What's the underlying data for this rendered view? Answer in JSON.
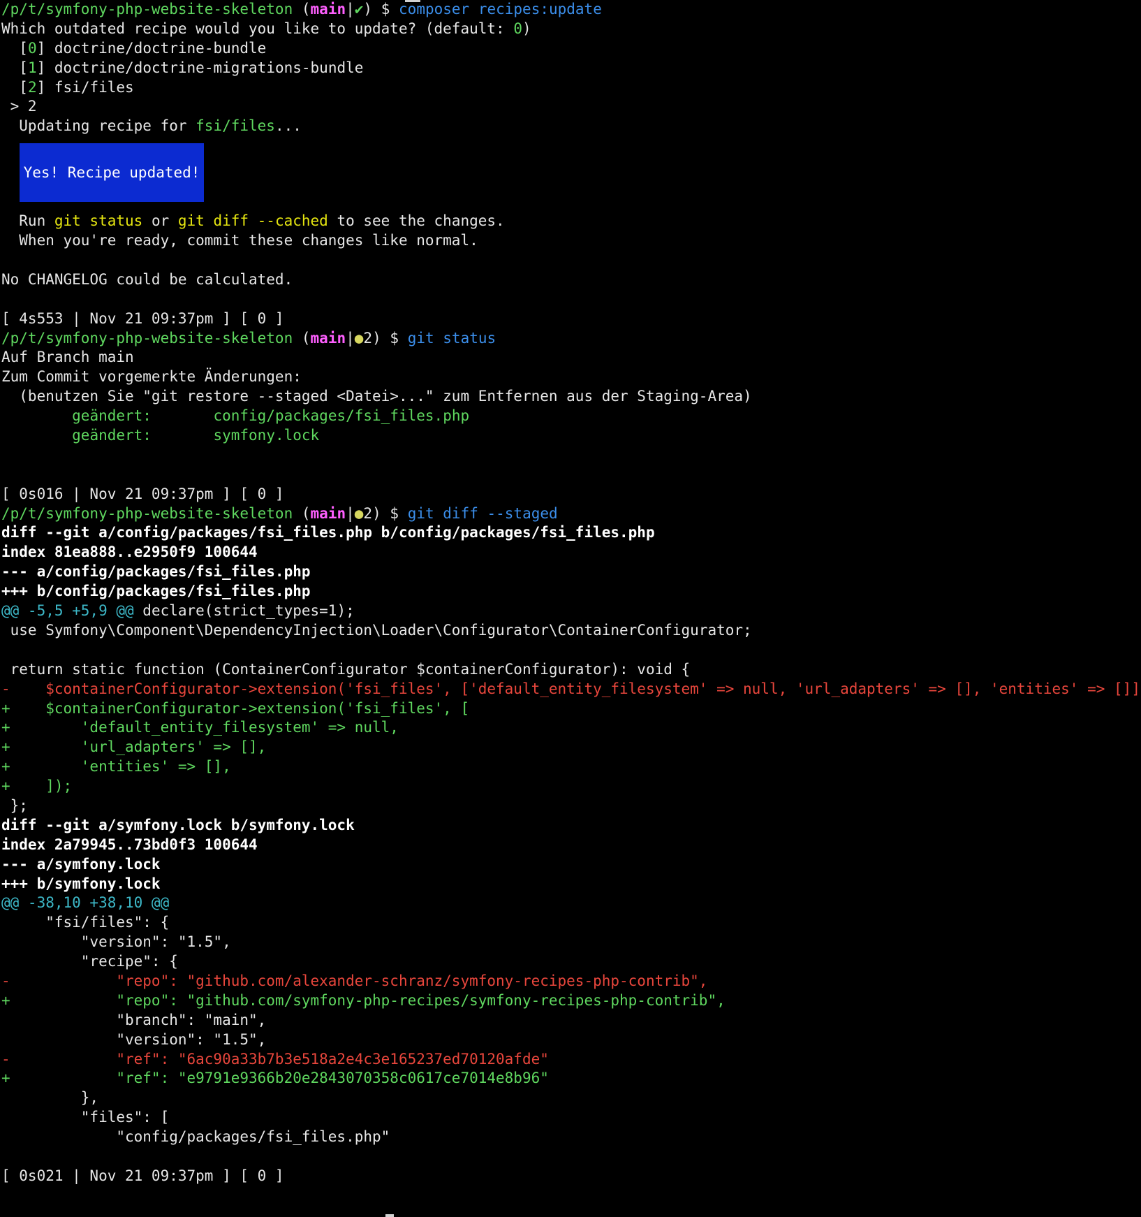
{
  "prompt": {
    "path": "/p/t/symfony-php-website-skeleton",
    "branch": "main",
    "clean_mark": "✔",
    "dirty_mark": "●",
    "dirty_count": "2",
    "dollar": "$"
  },
  "cmd1": {
    "binary": "composer",
    "args": "recipes:update"
  },
  "question": {
    "text": "Which outdated recipe would you like to update? (default: ",
    "default_value": "0",
    "close": ")"
  },
  "options": [
    {
      "index": "0",
      "name": "doctrine/doctrine-bundle"
    },
    {
      "index": "1",
      "name": "doctrine/doctrine-migrations-bundle"
    },
    {
      "index": "2",
      "name": "fsi/files"
    }
  ],
  "answer": " > 2",
  "updating": {
    "prefix": "  Updating recipe for ",
    "package": "fsi/files",
    "suffix": "..."
  },
  "banner": {
    "text": "Yes! Recipe updated!"
  },
  "hint": {
    "run": "  Run ",
    "git_status": "git status",
    "or": " or ",
    "git_diff": "git diff --cached",
    "tail": " to see the changes.",
    "line2": "  When you're ready, commit these changes like normal."
  },
  "changelog": "No CHANGELOG could be calculated.",
  "timings": {
    "t1": "[ 4s553 | Nov 21 09:37pm ] [ 0 ]",
    "t2": "[ 0s016 | Nov 21 09:37pm ] [ 0 ]",
    "t3": "[ 0s021 | Nov 21 09:37pm ] [ 0 ]"
  },
  "cmd2": {
    "binary": "git",
    "args": "status"
  },
  "status": {
    "branch_line": "Auf Branch main",
    "staged_header": "Zum Commit vorgemerkte Änderungen:",
    "restore_hint": "  (benutzen Sie \"git restore --staged <Datei>...\" zum Entfernen aus der Staging-Area)",
    "files": [
      {
        "label": "geändert:",
        "path": "config/packages/fsi_files.php"
      },
      {
        "label": "geändert:",
        "path": "symfony.lock"
      }
    ]
  },
  "cmd3": {
    "binary": "git",
    "args": "diff --staged"
  },
  "diff1": {
    "header": "diff --git a/config/packages/fsi_files.php b/config/packages/fsi_files.php",
    "index": "index 81ea888..e2950f9 100644",
    "minus_file": "--- a/config/packages/fsi_files.php",
    "plus_file": "+++ b/config/packages/fsi_files.php",
    "hunk": "@@ -5,5 +5,9 @@",
    "hunk_context": " declare(strict_types=1);",
    "lines": [
      {
        "type": "ctx",
        "text": " use Symfony\\Component\\DependencyInjection\\Loader\\Configurator\\ContainerConfigurator;"
      },
      {
        "type": "ctx",
        "text": ""
      },
      {
        "type": "ctx",
        "text": " return static function (ContainerConfigurator $containerConfigurator): void {"
      },
      {
        "type": "del",
        "text": "-    $containerConfigurator->extension('fsi_files', ['default_entity_filesystem' => null, 'url_adapters' => [], 'entities' => []]);"
      },
      {
        "type": "add",
        "text": "+    $containerConfigurator->extension('fsi_files', ["
      },
      {
        "type": "add",
        "text": "+        'default_entity_filesystem' => null,"
      },
      {
        "type": "add",
        "text": "+        'url_adapters' => [],"
      },
      {
        "type": "add",
        "text": "+        'entities' => [],"
      },
      {
        "type": "add",
        "text": "+    ]);"
      },
      {
        "type": "ctx",
        "text": " };"
      }
    ]
  },
  "diff2": {
    "header": "diff --git a/symfony.lock b/symfony.lock",
    "index": "index 2a79945..73bd0f3 100644",
    "minus_file": "--- a/symfony.lock",
    "plus_file": "+++ b/symfony.lock",
    "hunk": "@@ -38,10 +38,10 @@",
    "lines": [
      {
        "type": "ctx",
        "text": "     \"fsi/files\": {"
      },
      {
        "type": "ctx",
        "text": "         \"version\": \"1.5\","
      },
      {
        "type": "ctx",
        "text": "         \"recipe\": {"
      },
      {
        "type": "del",
        "text": "-            \"repo\": \"github.com/alexander-schranz/symfony-recipes-php-contrib\","
      },
      {
        "type": "add",
        "text": "+            \"repo\": \"github.com/symfony-php-recipes/symfony-recipes-php-contrib\","
      },
      {
        "type": "ctx",
        "text": "             \"branch\": \"main\","
      },
      {
        "type": "ctx",
        "text": "             \"version\": \"1.5\","
      },
      {
        "type": "del",
        "text": "-            \"ref\": \"6ac90a33b7b3e518a2e4c3e165237ed70120afde\""
      },
      {
        "type": "add",
        "text": "+            \"ref\": \"e9791e9366b20e2843070358c0617ce7014e8b96\""
      },
      {
        "type": "ctx",
        "text": "         },"
      },
      {
        "type": "ctx",
        "text": "         \"files\": ["
      },
      {
        "type": "ctx",
        "text": "             \"config/packages/fsi_files.php\""
      }
    ]
  },
  "colors": {
    "background": "#000000",
    "foreground": "#e6e6e6",
    "path": "#5fd75f",
    "branch": "#ff5fff",
    "command": "#3b8eea",
    "added": "#5fd75f",
    "removed": "#e8463c",
    "hunk": "#3db8c8",
    "highlight": "#e5e510",
    "banner_bg": "#0c2bd1"
  }
}
